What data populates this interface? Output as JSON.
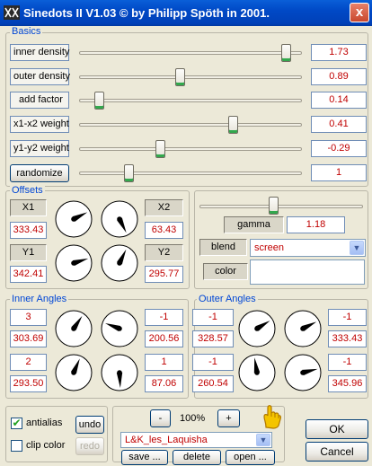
{
  "window": {
    "title": "Sinedots II V1.03 © by Philipp Spöth in 2001.",
    "close_label": "x"
  },
  "basics": {
    "label": "Basics",
    "rows": [
      {
        "label": "inner density",
        "value": "1.73",
        "position": 0.95
      },
      {
        "label": "outer density",
        "value": "0.89",
        "position": 0.45
      },
      {
        "label": "add factor",
        "value": "0.14",
        "position": 0.07
      },
      {
        "label": "x1-x2 weight",
        "value": "0.41",
        "position": 0.7
      },
      {
        "label": "y1-y2 weight",
        "value": "-0.29",
        "position": 0.36
      },
      {
        "label": "randomize",
        "value": "1",
        "position": 0.21
      }
    ]
  },
  "offsets": {
    "label": "Offsets",
    "x1": {
      "label": "X1",
      "value": "333.43"
    },
    "x2": {
      "label": "X2",
      "value": "63.43"
    },
    "y1": {
      "label": "Y1",
      "value": "342.41"
    },
    "y2": {
      "label": "Y2",
      "value": "295.77"
    }
  },
  "gamma": {
    "label": "gamma",
    "value": "1.18",
    "position": 0.45
  },
  "blend": {
    "label": "blend",
    "value": "screen"
  },
  "color": {
    "label": "color",
    "value": ""
  },
  "inner_angles": {
    "label": "Inner Angles",
    "a": {
      "top": "3",
      "bottom": "303.69"
    },
    "b": {
      "top": "-1",
      "bottom": "200.56"
    },
    "c": {
      "top": "2",
      "bottom": "293.50"
    },
    "d": {
      "top": "1",
      "bottom": "87.06"
    }
  },
  "outer_angles": {
    "label": "Outer Angles",
    "a": {
      "top": "-1",
      "bottom": "328.57"
    },
    "b": {
      "top": "-1",
      "bottom": "333.43"
    },
    "c": {
      "top": "-1",
      "bottom": "260.54"
    },
    "d": {
      "top": "-1",
      "bottom": "345.96"
    }
  },
  "bottom": {
    "antialias_label": "antialias",
    "antialias_checked": true,
    "clip_color_label": "clip color",
    "clip_color_checked": false,
    "undo_label": "undo",
    "redo_label": "redo",
    "zoom_minus": "-",
    "zoom_value": "100%",
    "zoom_plus": "+",
    "preset": "L&K_les_Laquisha",
    "save_label": "save ...",
    "delete_label": "delete",
    "open_label": "open ...",
    "ok_label": "OK",
    "cancel_label": "Cancel"
  },
  "dials": {
    "offset_x1": 333.43,
    "offset_x2": 63.43,
    "offset_y1": 342.41,
    "offset_y2": 295.77,
    "inner_a": 303.69,
    "inner_b": 200.56,
    "inner_c": 293.5,
    "inner_d": 87.06,
    "outer_a": 328.57,
    "outer_b": 333.43,
    "outer_c": 260.54,
    "outer_d": 345.96
  },
  "colors": {
    "title_bar": "#0049c6",
    "accent": "#0046d5",
    "value_text": "#c00000",
    "slider_tick": "#32a84d"
  }
}
